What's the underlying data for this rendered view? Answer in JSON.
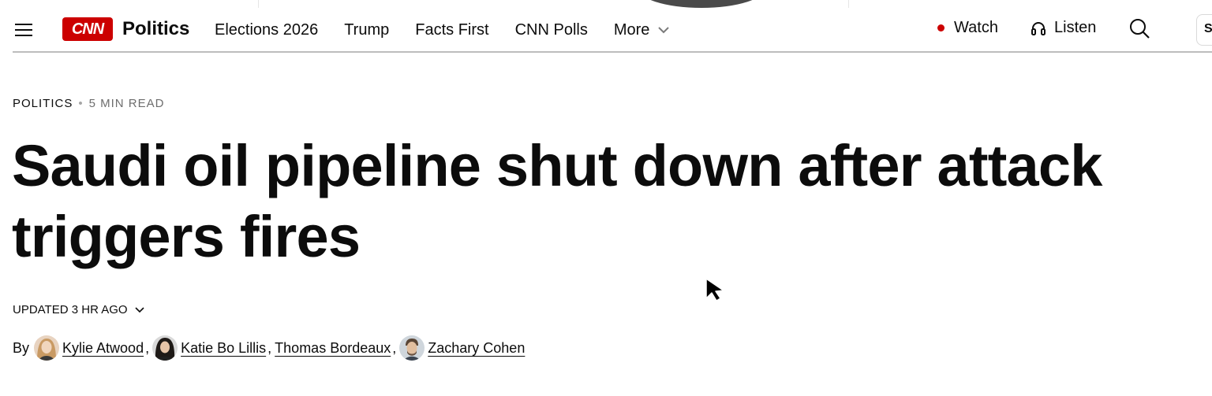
{
  "header": {
    "section_name": "Politics",
    "logo_text": "CNN",
    "nav_items": [
      "Elections 2026",
      "Trump",
      "Facts First",
      "CNN Polls"
    ],
    "more_label": "More",
    "watch_label": "Watch",
    "listen_label": "Listen",
    "signin_partial": "S"
  },
  "article": {
    "section": "POLITICS",
    "read_time": "5 MIN READ",
    "headline": "Saudi oil pipeline shut down after attack triggers fires",
    "updated": "UPDATED 3 HR AGO",
    "by_label": "By",
    "authors": [
      "Kylie Atwood",
      "Katie Bo Lillis",
      "Thomas Bordeaux",
      "Zachary Cohen"
    ]
  },
  "colors": {
    "brand_red": "#cc0000",
    "text": "#0c0c0c",
    "muted": "#6e6e6e",
    "rule": "#bdbdbd"
  },
  "icons": [
    "menu-icon",
    "cnn-logo",
    "chevron-down-icon",
    "live-dot-icon",
    "headphones-icon",
    "search-icon",
    "cursor-icon"
  ]
}
